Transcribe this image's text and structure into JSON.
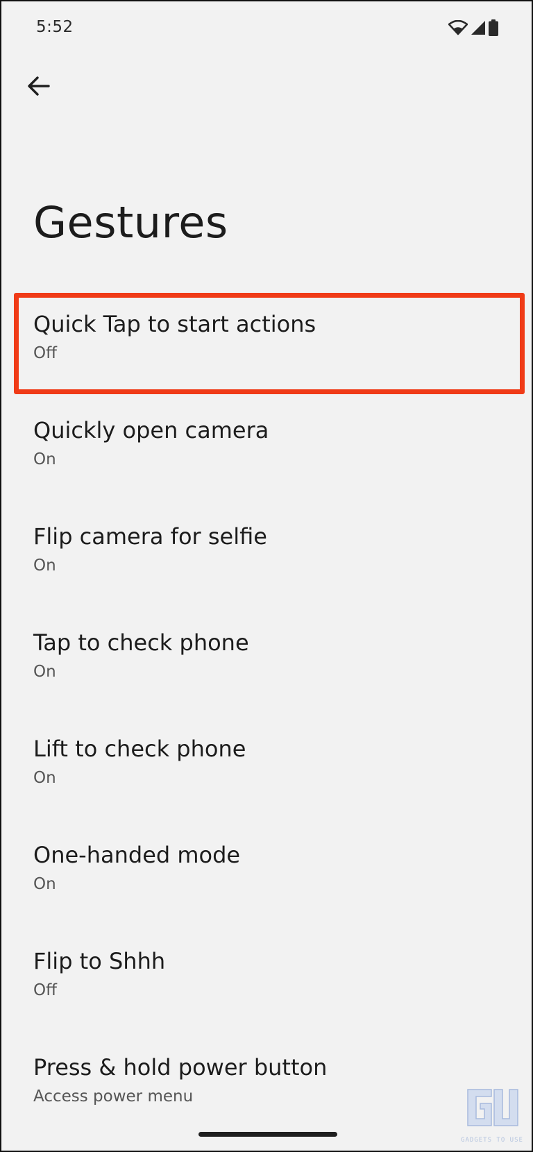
{
  "status_bar": {
    "time": "5:52",
    "icons": [
      "wifi-icon",
      "cellular-signal-icon",
      "battery-icon"
    ]
  },
  "header": {
    "back_icon": "arrow-left-icon",
    "title": "Gestures"
  },
  "settings": [
    {
      "title": "Quick Tap to start actions",
      "summary": "Off",
      "highlighted": true
    },
    {
      "title": "Quickly open camera",
      "summary": "On"
    },
    {
      "title": "Flip camera for selfie",
      "summary": "On"
    },
    {
      "title": "Tap to check phone",
      "summary": "On"
    },
    {
      "title": "Lift to check phone",
      "summary": "On"
    },
    {
      "title": "One-handed mode",
      "summary": "On"
    },
    {
      "title": "Flip to Shhh",
      "summary": "Off"
    },
    {
      "title": "Press & hold power button",
      "summary": "Access power menu"
    }
  ],
  "annotation": {
    "highlight_color": "#f03b17"
  },
  "watermark": {
    "logo_letters": "GU",
    "text": "GADGETS TO USE"
  },
  "colors": {
    "background": "#f2f2f2",
    "title_text": "#1c1c1c",
    "summary_text": "#555555"
  }
}
